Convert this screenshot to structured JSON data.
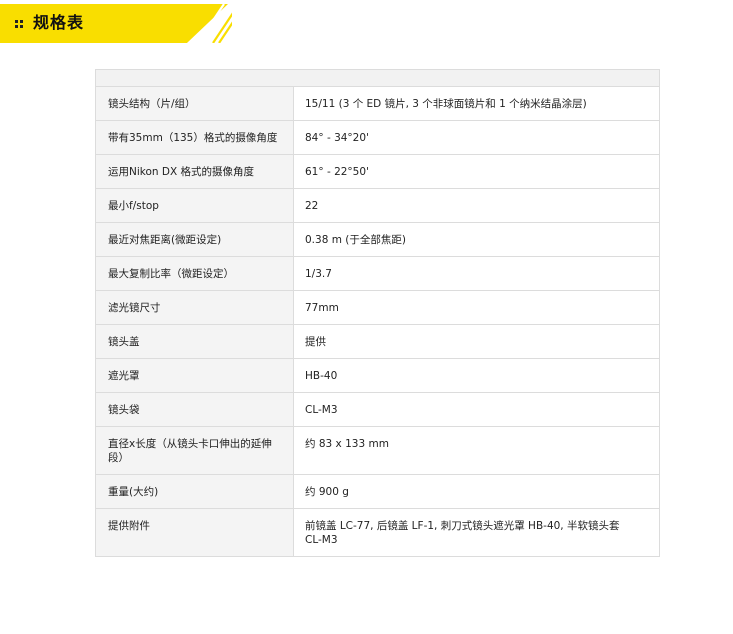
{
  "header": {
    "title": "规格表",
    "accent_color": "#f9de00",
    "icon": "bullet-grid-icon"
  },
  "specs": [
    {
      "label": "镜头结构（片/组）",
      "value": "15/11 (3 个 ED 镜片, 3 个非球面镜片和 1 个纳米结晶涂层)"
    },
    {
      "label": "带有35mm（135）格式的摄像角度",
      "value": "84° - 34°20'"
    },
    {
      "label": "运用Nikon DX 格式的摄像角度",
      "value": "61° - 22°50'"
    },
    {
      "label": "最小f/stop",
      "value": "22"
    },
    {
      "label": "最近对焦距离(微距设定)",
      "value": "0.38 m (于全部焦距)"
    },
    {
      "label": "最大复制比率（微距设定）",
      "value": "1/3.7"
    },
    {
      "label": "滤光镜尺寸",
      "value": "77mm"
    },
    {
      "label": "镜头盖",
      "value": "提供"
    },
    {
      "label": "遮光罩",
      "value": "HB-40"
    },
    {
      "label": "镜头袋",
      "value": "CL-M3"
    },
    {
      "label": "直径x长度（从镜头卡口伸出的延伸段）",
      "value": "约 83 x 133 mm"
    },
    {
      "label": "重量(大约)",
      "value": "约 900 g"
    },
    {
      "label": "提供附件",
      "value": "前镜盖 LC-77, 后镜盖 LF-1, 刺刀式镜头遮光罩 HB-40, 半软镜头套 CL-M3"
    }
  ]
}
